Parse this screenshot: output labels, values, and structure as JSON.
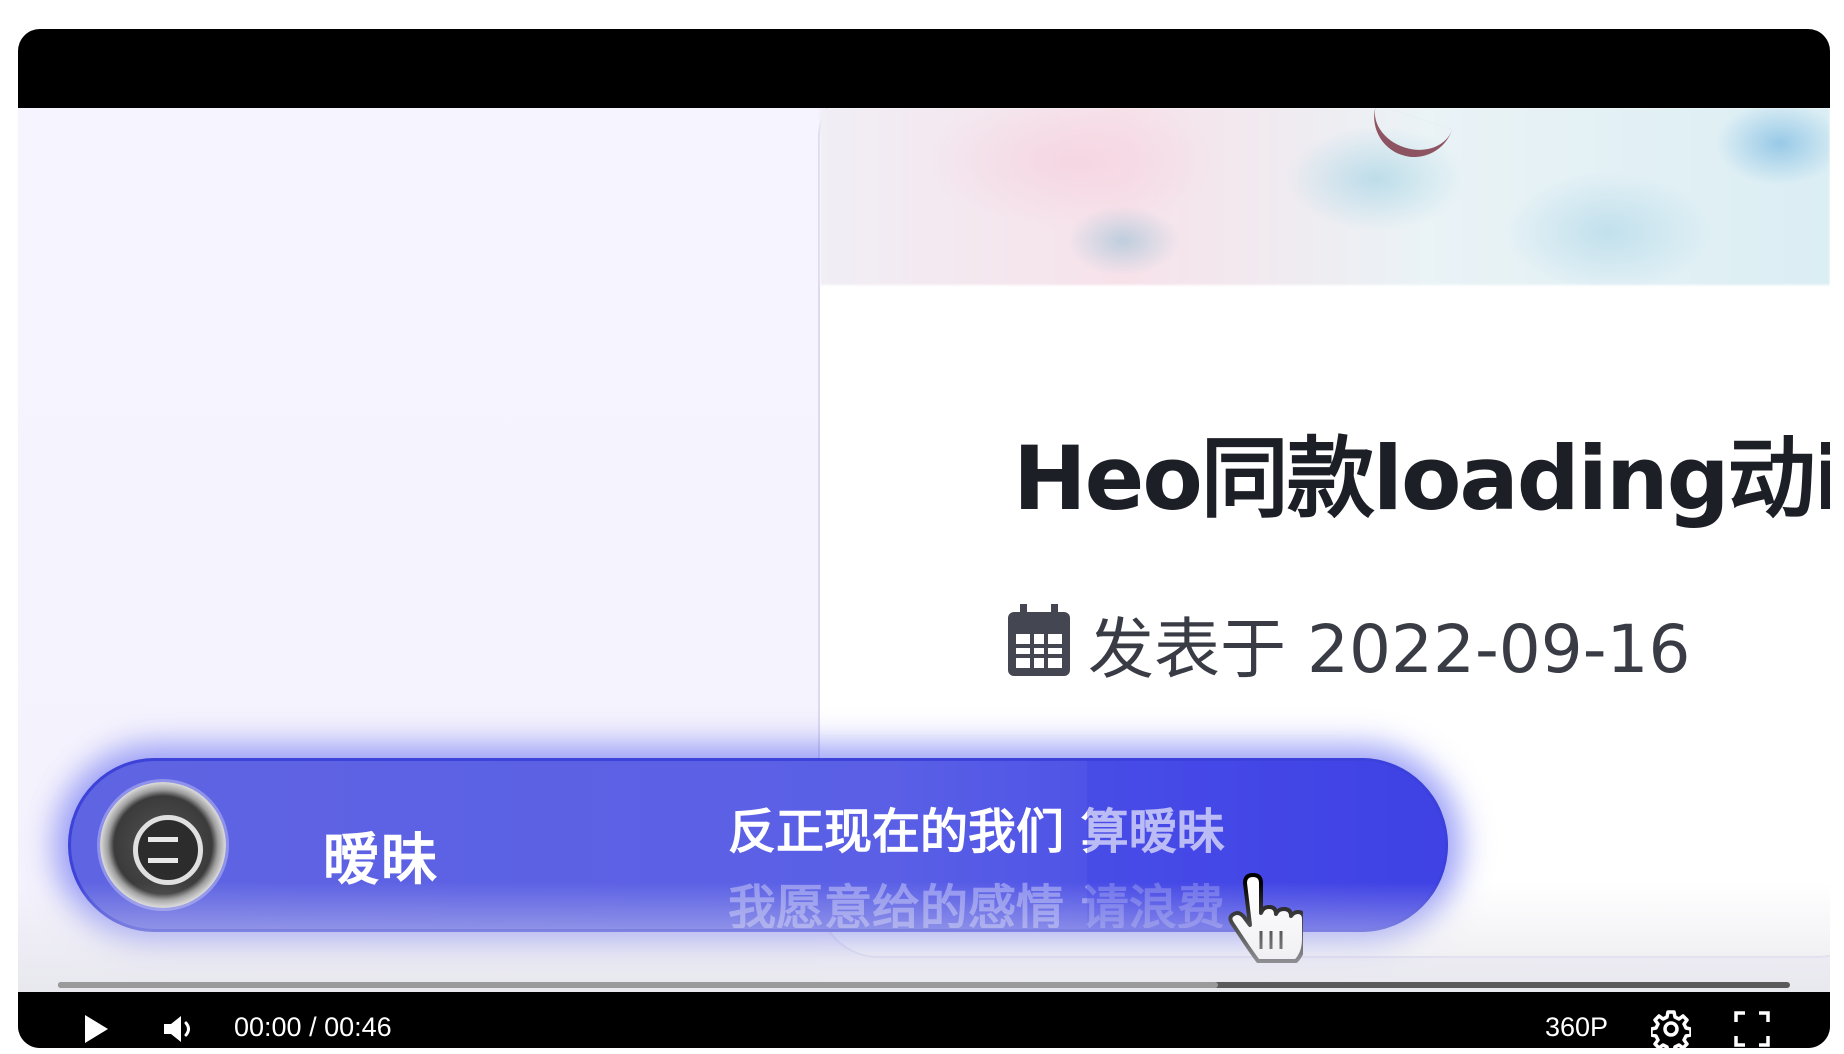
{
  "video": {
    "article": {
      "title": "Heo同款loading动i",
      "date_label": "发表于 2022-09-16"
    },
    "music_capsule": {
      "song_name": "暧昧",
      "lyrics_current": "反正现在的我们 算暧昧",
      "lyrics_next": "我愿意给的感情 请浪费"
    }
  },
  "controls": {
    "current_time": "00:00",
    "separator": " / ",
    "duration": "00:46",
    "quality": "360P",
    "progress_fraction": 0.0,
    "buffered_fraction": 0.67
  },
  "colors": {
    "capsule": "#5a5fe6",
    "player_bg": "#000000"
  },
  "icons": {
    "play": "play-icon",
    "volume": "volume-icon",
    "settings": "gear-icon",
    "fullscreen": "fullscreen-icon",
    "calendar": "calendar-icon",
    "cursor": "hand-cursor-icon"
  }
}
